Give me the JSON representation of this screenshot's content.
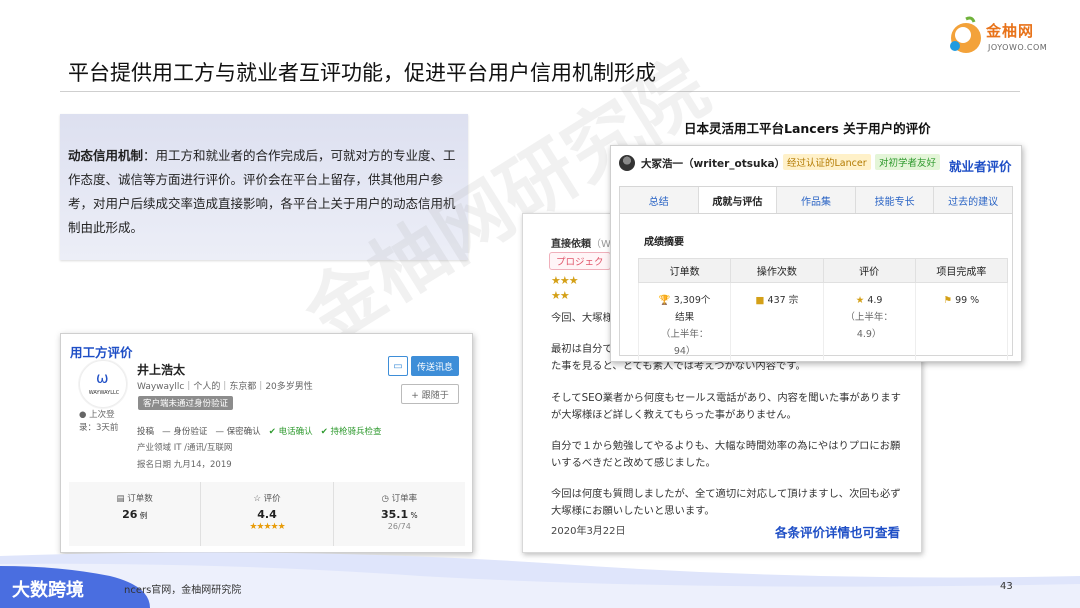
{
  "logo": {
    "brand": "金柚网",
    "sub": "JOYOWO.COM"
  },
  "page_title": "平台提供用工方与就业者互评功能，促进平台用户信用机制形成",
  "definition": {
    "term": "动态信用机制",
    "text": "：用工方和就业者的合作完成后，可就对方的专业度、工作态度、诚信等方面进行评价。评价会在平台上留存，供其他用户参考，对用户后续成交率造成直接影响，各平台上关于用户的动态信用机制由此形成。"
  },
  "lancers_caption": "日本灵活用工平台Lancers  关于用户的评价",
  "review": {
    "header": "直接依頼",
    "header_extra": "（W",
    "tag": "プロジェク",
    "stars1": "★★★",
    "stars2": "★★",
    "lines": [
      "今回、大塚様",
      "最初は自分で",
      "た事を見ると、とても素人では考えつかない内容です。",
      "そしてSEO業者から何度もセールス電話があり、内容を聞いた事があります",
      "が大塚様ほど詳しく教えてもらった事がありません。",
      "自分で１から勉強してやるよりも、大幅な時間効率の為にやはりプロにお願",
      "いするべきだと改めて感じました。",
      "今回は何度も質問しましたが、全て適切に対応して頂けますし、次回も必ず",
      "大塚様にお願いしたいと思います。"
    ],
    "date": "2020年3月22日",
    "detail_link": "各条评价详情也可查看"
  },
  "freelancer": {
    "name": "大冢浩一（writer_otsuka）",
    "badge_verified": "经过认证的Lancer",
    "badge_friendly": "对初学者友好",
    "panel_label": "就业者评价",
    "tabs": [
      "总结",
      "成就与评估",
      "作品集",
      "技能专长",
      "过去的建议"
    ],
    "active_tab": 1,
    "summary_title": "成绩摘要",
    "stats_headers": [
      "订单数",
      "操作次数",
      "评价",
      "项目完成率"
    ],
    "stats": {
      "orders_main": "3,309个",
      "orders_sub": "结果",
      "orders_prev_label": "（上半年：",
      "orders_prev_value": "94）",
      "operations": "437 宗",
      "rating": "4.9",
      "rating_prev_label": "（上半年：",
      "rating_prev_value": "4.9）",
      "completion": "99 %"
    }
  },
  "employer": {
    "panel_label": "用工方评价",
    "logo_text": "WAYWAYLLC",
    "name": "井上浩太",
    "meta": "Waywayllc｜个人的｜东京都｜20多岁男性",
    "warn_badge": "客户端未通过身份验证",
    "last_login_label": "● 上次登",
    "last_login_value": "录：3天前",
    "verify_prefix": "投稿",
    "verify_items": [
      "— 身份验证",
      "— 保密确认",
      "✔ 电话确认",
      "✔ 持枪骑兵检查"
    ],
    "industry": "产业领域  IT /通讯/互联网",
    "reg_date": "报名日期  九月14，2019",
    "msg_button": "传送讯息",
    "follow_button": "+ 跟随于",
    "stats": [
      {
        "label": "订单数",
        "value": "26",
        "unit": " 例"
      },
      {
        "label": "评价",
        "value": "4.4",
        "stars": "★★★★★"
      },
      {
        "label": "订单率",
        "value": "35.1",
        "unit": " %",
        "sub": "26/74"
      }
    ]
  },
  "watermark": "金柚网研究院",
  "footer": {
    "brand": "大数跨境",
    "source": "ncers官网，金柚网研究院",
    "page_number": "43"
  },
  "colors": {
    "accent_blue": "#1f4fc6",
    "brand_orange": "#e8731a",
    "button_blue": "#3e8ed8",
    "footer_blue": "#4a6ee0"
  }
}
